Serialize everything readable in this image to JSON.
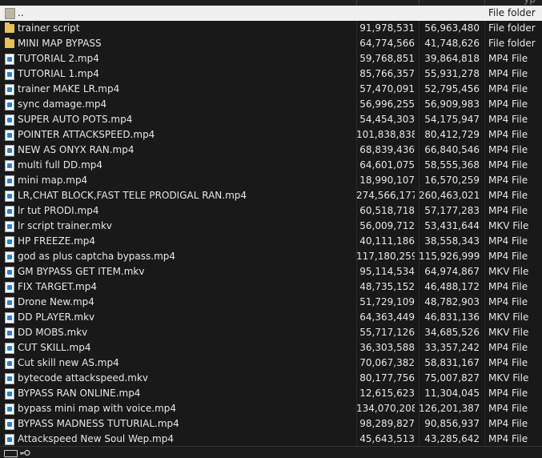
{
  "header": {
    "hint": "yp"
  },
  "parent_row": {
    "name": "..",
    "type": "File folder"
  },
  "rows": [
    {
      "name": "trainer script",
      "size": "91,978,531",
      "packed": "56,963,480",
      "type": "File folder",
      "icon": "folder"
    },
    {
      "name": "MINI MAP BYPASS",
      "size": "64,774,566",
      "packed": "41,748,626",
      "type": "File folder",
      "icon": "folder"
    },
    {
      "name": "TUTORIAL 2.mp4",
      "size": "59,768,851",
      "packed": "39,864,818",
      "type": "MP4 File",
      "icon": "video"
    },
    {
      "name": "TUTORIAL 1.mp4",
      "size": "85,766,357",
      "packed": "55,931,278",
      "type": "MP4 File",
      "icon": "video"
    },
    {
      "name": "trainer MAKE LR.mp4",
      "size": "57,470,091",
      "packed": "52,795,456",
      "type": "MP4 File",
      "icon": "video"
    },
    {
      "name": "sync damage.mp4",
      "size": "56,996,255",
      "packed": "56,909,983",
      "type": "MP4 File",
      "icon": "video"
    },
    {
      "name": "SUPER AUTO POTS.mp4",
      "size": "54,454,303",
      "packed": "54,175,947",
      "type": "MP4 File",
      "icon": "video"
    },
    {
      "name": "POINTER ATTACKSPEED.mp4",
      "size": "101,838,838",
      "packed": "80,412,729",
      "type": "MP4 File",
      "icon": "video"
    },
    {
      "name": "NEW AS ONYX RAN.mp4",
      "size": "68,839,436",
      "packed": "66,840,546",
      "type": "MP4 File",
      "icon": "video"
    },
    {
      "name": "multi full DD.mp4",
      "size": "64,601,075",
      "packed": "58,555,368",
      "type": "MP4 File",
      "icon": "video"
    },
    {
      "name": "mini map.mp4",
      "size": "18,990,107",
      "packed": "16,570,259",
      "type": "MP4 File",
      "icon": "video"
    },
    {
      "name": "LR,CHAT BLOCK,FAST TELE PRODIGAL RAN.mp4",
      "size": "274,566,177",
      "packed": "260,463,021",
      "type": "MP4 File",
      "icon": "video"
    },
    {
      "name": "lr tut PRODI.mp4",
      "size": "60,518,718",
      "packed": "57,177,283",
      "type": "MP4 File",
      "icon": "video"
    },
    {
      "name": "lr script trainer.mkv",
      "size": "56,009,712",
      "packed": "53,431,644",
      "type": "MKV File",
      "icon": "video"
    },
    {
      "name": "HP FREEZE.mp4",
      "size": "40,111,186",
      "packed": "38,558,343",
      "type": "MP4 File",
      "icon": "video"
    },
    {
      "name": "god as plus captcha bypass.mp4",
      "size": "117,180,259",
      "packed": "115,926,999",
      "type": "MP4 File",
      "icon": "video"
    },
    {
      "name": "GM BYPASS GET ITEM.mkv",
      "size": "95,114,534",
      "packed": "64,974,867",
      "type": "MKV File",
      "icon": "video"
    },
    {
      "name": "FIX TARGET.mp4",
      "size": "48,735,152",
      "packed": "46,488,172",
      "type": "MP4 File",
      "icon": "video"
    },
    {
      "name": "Drone New.mp4",
      "size": "51,729,109",
      "packed": "48,782,903",
      "type": "MP4 File",
      "icon": "video"
    },
    {
      "name": "DD PLAYER.mkv",
      "size": "64,363,449",
      "packed": "46,831,136",
      "type": "MKV File",
      "icon": "video"
    },
    {
      "name": "DD MOBS.mkv",
      "size": "55,717,126",
      "packed": "34,685,526",
      "type": "MKV File",
      "icon": "video"
    },
    {
      "name": "CUT SKILL.mp4",
      "size": "36,303,588",
      "packed": "33,357,242",
      "type": "MP4 File",
      "icon": "video"
    },
    {
      "name": "Cut skill new AS.mp4",
      "size": "70,067,382",
      "packed": "58,831,167",
      "type": "MP4 File",
      "icon": "video"
    },
    {
      "name": "bytecode attackspeed.mkv",
      "size": "80,177,756",
      "packed": "75,007,827",
      "type": "MKV File",
      "icon": "video"
    },
    {
      "name": "BYPASS RAN ONLINE.mp4",
      "size": "12,615,623",
      "packed": "11,304,045",
      "type": "MP4 File",
      "icon": "video"
    },
    {
      "name": "bypass mini map with voice.mp4",
      "size": "134,070,208",
      "packed": "126,201,387",
      "type": "MP4 File",
      "icon": "video"
    },
    {
      "name": "BYPASS MADNESS TUTURIAL.mp4",
      "size": "98,289,827",
      "packed": "90,856,937",
      "type": "MP4 File",
      "icon": "video"
    },
    {
      "name": "Attackspeed New Soul Wep.mp4",
      "size": "45,643,513",
      "packed": "43,285,642",
      "type": "MP4 File",
      "icon": "video"
    }
  ]
}
